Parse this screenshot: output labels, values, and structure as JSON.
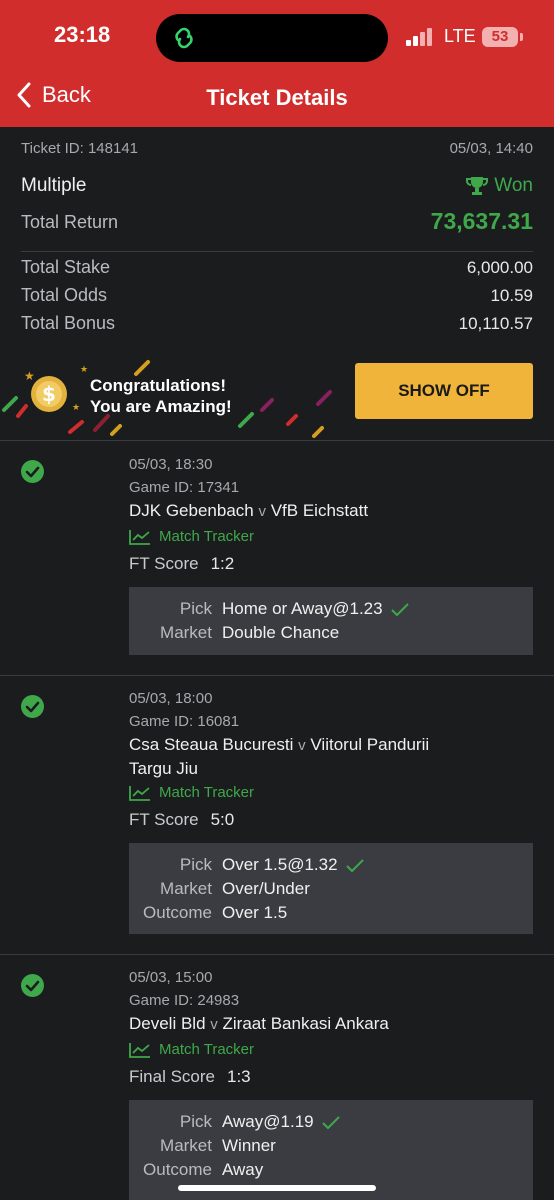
{
  "status_bar": {
    "time": "23:18",
    "network": "LTE",
    "battery": "53"
  },
  "nav": {
    "back_label": "Back",
    "title": "Ticket Details"
  },
  "ticket": {
    "id_label": "Ticket ID: 148141",
    "datetime": "05/03, 14:40",
    "type": "Multiple",
    "status": "Won",
    "total_return_label": "Total Return",
    "total_return": "73,637.31",
    "stake_label": "Total Stake",
    "stake": "6,000.00",
    "odds_label": "Total Odds",
    "odds": "10.59",
    "bonus_label": "Total Bonus",
    "bonus": "10,110.57"
  },
  "banner": {
    "line1": "Congratulations!",
    "line2": "You are Amazing!",
    "button": "SHOW OFF"
  },
  "selections": [
    {
      "date": "05/03, 18:30",
      "game_id": "Game ID: 17341",
      "home": "DJK Gebenbach",
      "vs": "v",
      "away": "VfB Eichstatt",
      "away_line2": "",
      "tracker": "Match Tracker",
      "score_label": "FT Score",
      "score": "1:2",
      "pick_label": "Pick",
      "pick": "Home or Away@1.23",
      "market_label": "Market",
      "market": "Double Chance"
    },
    {
      "date": "05/03, 18:00",
      "game_id": "Game ID: 16081",
      "home": "Csa Steaua Bucuresti",
      "vs": "v",
      "away": "Viitorul Pandurii",
      "away_line2": "Targu Jiu",
      "tracker": "Match Tracker",
      "score_label": "FT Score",
      "score": "5:0",
      "pick_label": "Pick",
      "pick": "Over 1.5@1.32",
      "market_label": "Market",
      "market": "Over/Under",
      "outcome_label": "Outcome",
      "outcome": "Over 1.5"
    },
    {
      "date": "05/03, 15:00",
      "game_id": "Game ID: 24983",
      "home": "Develi Bld",
      "vs": "v",
      "away": "Ziraat Bankasi Ankara",
      "away_line2": "",
      "tracker": "Match Tracker",
      "score_label": "Final Score",
      "score": "1:3",
      "pick_label": "Pick",
      "pick": "Away@1.19",
      "market_label": "Market",
      "market": "Winner",
      "outcome_label": "Outcome",
      "outcome": "Away"
    }
  ],
  "colors": {
    "header_red": "#d12d2d",
    "win_green": "#3fa84b",
    "button_yellow": "#f0b43a",
    "background": "#1b1c1e"
  }
}
